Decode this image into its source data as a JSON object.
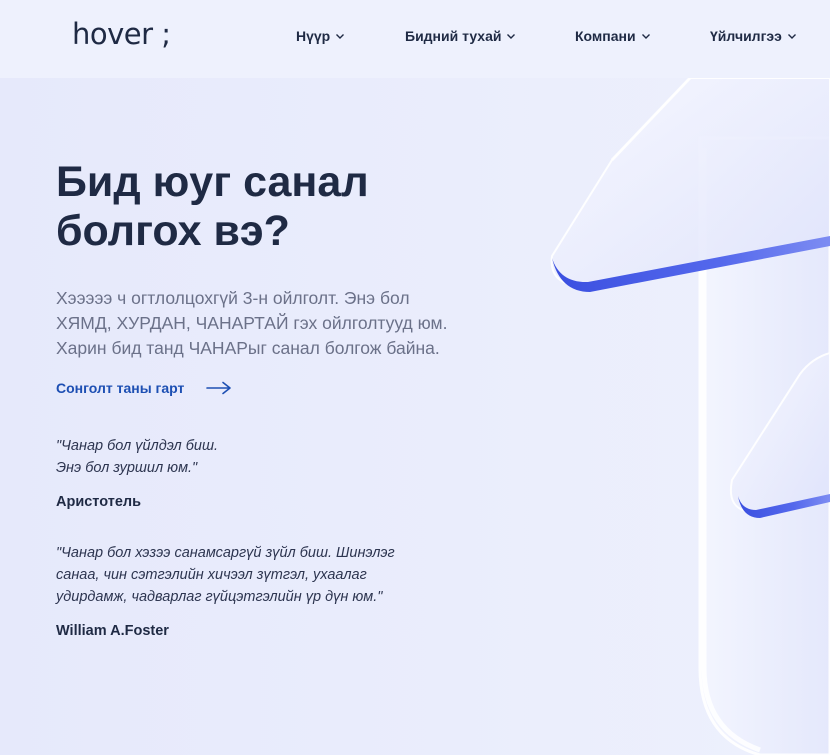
{
  "header": {
    "logo": "hover ;",
    "nav": [
      {
        "label": "Нүүр"
      },
      {
        "label": "Бидний тухай"
      },
      {
        "label": "Компани"
      },
      {
        "label": "Үйлчилгээ"
      }
    ]
  },
  "hero": {
    "title_line1": "Бид юуг санал",
    "title_line2": "болгох вэ?",
    "description": [
      "Хэээээ ч огтлолцохгүй 3-н ойлголт. Энэ бол",
      "ХЯМД, ХУРДАН, ЧАНАРТАЙ гэх ойлголтууд юм.",
      "Харин бид танд ЧАНАРыг санал болгож байна."
    ],
    "cta_label": "Сонголт таны гарт",
    "cta_icon": "arrow-right-icon"
  },
  "quotes": [
    {
      "lines": [
        "\"Чанар бол үйлдэл биш.",
        "Энэ бол зуршил юм.\""
      ],
      "author": "Аристотель"
    },
    {
      "lines": [
        "\"Чанар бол хэзээ санамсаргүй зүйл биш. Шинэлэг",
        "санаа, чин сэтгэлийн хичээл зүтгэл, ухаалаг",
        "удирдамж, чадварлаг гүйцэтгэлийн үр дүн юм.\""
      ],
      "author": "William A.Foster"
    }
  ],
  "colors": {
    "text_dark": "#1f2a44",
    "text_muted": "#6b7189",
    "link_blue": "#1d4fb3",
    "background": "#eceffd",
    "accent_glass": "#4f63e6"
  }
}
